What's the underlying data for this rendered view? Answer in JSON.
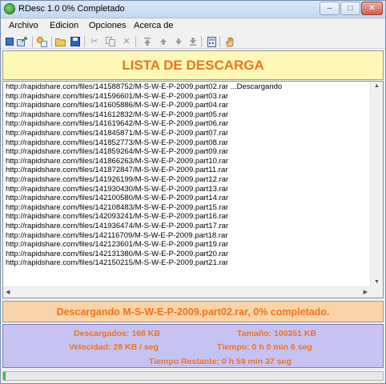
{
  "window": {
    "title": "RDesc 1.0  0% Completado",
    "controls": {
      "minimize": "–",
      "maximize": "□",
      "close": "✕"
    }
  },
  "menu": [
    "Archivo",
    "Edicion",
    "Opciones",
    "Acerca de"
  ],
  "toolbar": {
    "icons": [
      "new-icon",
      "export-icon",
      "add-link-icon",
      "open-folder-icon",
      "save-icon",
      "cut-icon",
      "copy-icon",
      "delete-icon",
      "move-top-icon",
      "move-up-icon",
      "move-down-icon",
      "move-bottom-icon",
      "calculator-icon",
      "hand-icon"
    ]
  },
  "header": {
    "title": "LISTA DE DESCARGA"
  },
  "downloads": [
    "http://rapidshare.com/files/141588752/M-S-W-E-P-2009.part02.rar ...Descargando",
    "http://rapidshare.com/files/141596601/M-S-W-E-P-2009.part03.rar",
    "http://rapidshare.com/files/141605886/M-S-W-E-P-2009.part04.rar",
    "http://rapidshare.com/files/141612832/M-S-W-E-P-2009.part05.rar",
    "http://rapidshare.com/files/141619642/M-S-W-E-P-2009.part06.rar",
    "http://rapidshare.com/files/141845871/M-S-W-E-P-2009.part07.rar",
    "http://rapidshare.com/files/141852773/M-S-W-E-P-2009.part08.rar",
    "http://rapidshare.com/files/141859264/M-S-W-E-P-2009.part09.rar",
    "http://rapidshare.com/files/141866263/M-S-W-E-P-2009.part10.rar",
    "http://rapidshare.com/files/141872847/M-S-W-E-P-2009.part11.rar",
    "http://rapidshare.com/files/141926199/M-S-W-E-P-2009.part12.rar",
    "http://rapidshare.com/files/141930430/M-S-W-E-P-2009.part13.rar",
    "http://rapidshare.com/files/142100580/M-S-W-E-P-2009.part14.rar",
    "http://rapidshare.com/files/142108483/M-S-W-E-P-2009.part15.rar",
    "http://rapidshare.com/files/142093241/M-S-W-E-P-2009.part16.rar",
    "http://rapidshare.com/files/141936474/M-S-W-E-P-2009.part17.rar",
    "http://rapidshare.com/files/142116709/M-S-W-E-P-2009.part18.rar",
    "http://rapidshare.com/files/142123601/M-S-W-E-P-2009.part19.rar",
    "http://rapidshare.com/files/142131380/M-S-W-E-P-2009.part20.rar",
    "http://rapidshare.com/files/142150215/M-S-W-E-P-2009.part21.rar"
  ],
  "status": {
    "text": "Descargando M-S-W-E-P-2009.part02.rar,  0% completado."
  },
  "stats": {
    "descargados": "Descargados:  168 KB",
    "tamano": "Tamaño:  100351 KB",
    "velocidad": "Velocidad:  28 KB / seg",
    "tiempo": "Tiempo: 0 h 0 min 6 seg",
    "restante": "Tiempo Restante: 0 h 59 min 37 seg"
  },
  "progress": {
    "fraction": 0.0017
  },
  "colors": {
    "accent": "#f0731e",
    "header_bg": "#fdf8b8",
    "status_bg": "#fbd3a8",
    "stats_bg": "#c6c3f3",
    "progress": "#39c43d"
  }
}
